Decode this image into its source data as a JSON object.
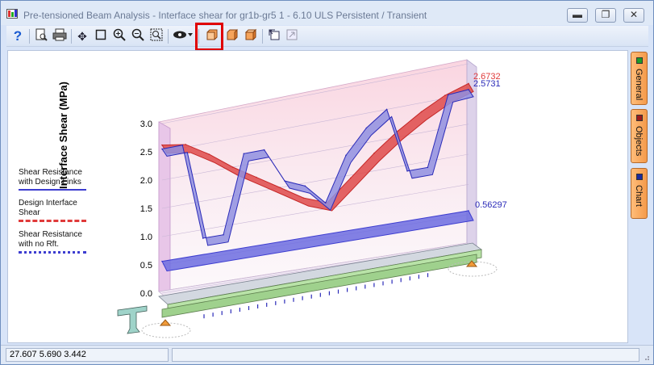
{
  "window": {
    "title": "Pre-tensioned Beam Analysis - Interface shear for gr1b-gr5 1 - 6.10 ULS Persistent / Transient",
    "minimize_icon": "minimize-icon",
    "restore_icon": "restore-icon",
    "close_icon": "close-icon"
  },
  "toolbar": {
    "icons": [
      "help-icon",
      "print-preview-icon",
      "print-icon",
      "pan-icon",
      "select-box-icon",
      "zoom-in-icon",
      "zoom-out-icon",
      "zoom-extents-icon",
      "view-icon",
      "view-front-icon",
      "view-side-icon",
      "view-3d-icon",
      "copy-icon",
      "export-icon"
    ],
    "highlight_color": "#e00000"
  },
  "chart_data": {
    "type": "line",
    "ylabel": "Interface Shear (MPa)",
    "ytick_labels": [
      "3.0",
      "2.5",
      "2.0",
      "1.5",
      "1.0",
      "0.5",
      "0.0"
    ],
    "ylim": [
      0,
      3.0
    ],
    "annotations": [
      "2.6732",
      "2.5731",
      "0.56297"
    ],
    "series": [
      {
        "name": "Shear Resistance with Design Links",
        "color": "#3d3dd0",
        "values": [
          2.55,
          2.55,
          0.85,
          0.85,
          2.2,
          2.2,
          1.6,
          1.45,
          1.1,
          1.85,
          2.25,
          2.5,
          1.4,
          1.4,
          2.55,
          2.5731
        ]
      },
      {
        "name": "Design Interface Shear",
        "color": "#e03a3a",
        "values": [
          2.62,
          2.55,
          2.3,
          2.0,
          1.75,
          1.5,
          1.25,
          1.1,
          1.45,
          1.8,
          2.1,
          2.35,
          2.55,
          2.6732
        ]
      },
      {
        "name": "Shear Resistance with no Rft.",
        "color": "#3d3dd0",
        "values": [
          0.56297,
          0.56297
        ]
      }
    ]
  },
  "legend": {
    "items": [
      {
        "label_line1": "Shear Resistance",
        "label_line2": "with Design Links"
      },
      {
        "label_line1": "Design Interface",
        "label_line2": "Shear"
      },
      {
        "label_line1": "Shear Resistance",
        "label_line2": "with no Rft."
      }
    ]
  },
  "side_tabs": [
    {
      "label": "General",
      "color": "#1c9c2a"
    },
    {
      "label": "Objects",
      "color": "#9c1c1c"
    },
    {
      "label": "Chart",
      "color": "#1c2a9c"
    }
  ],
  "status": {
    "coords": "27.607  5.690  3.442"
  }
}
